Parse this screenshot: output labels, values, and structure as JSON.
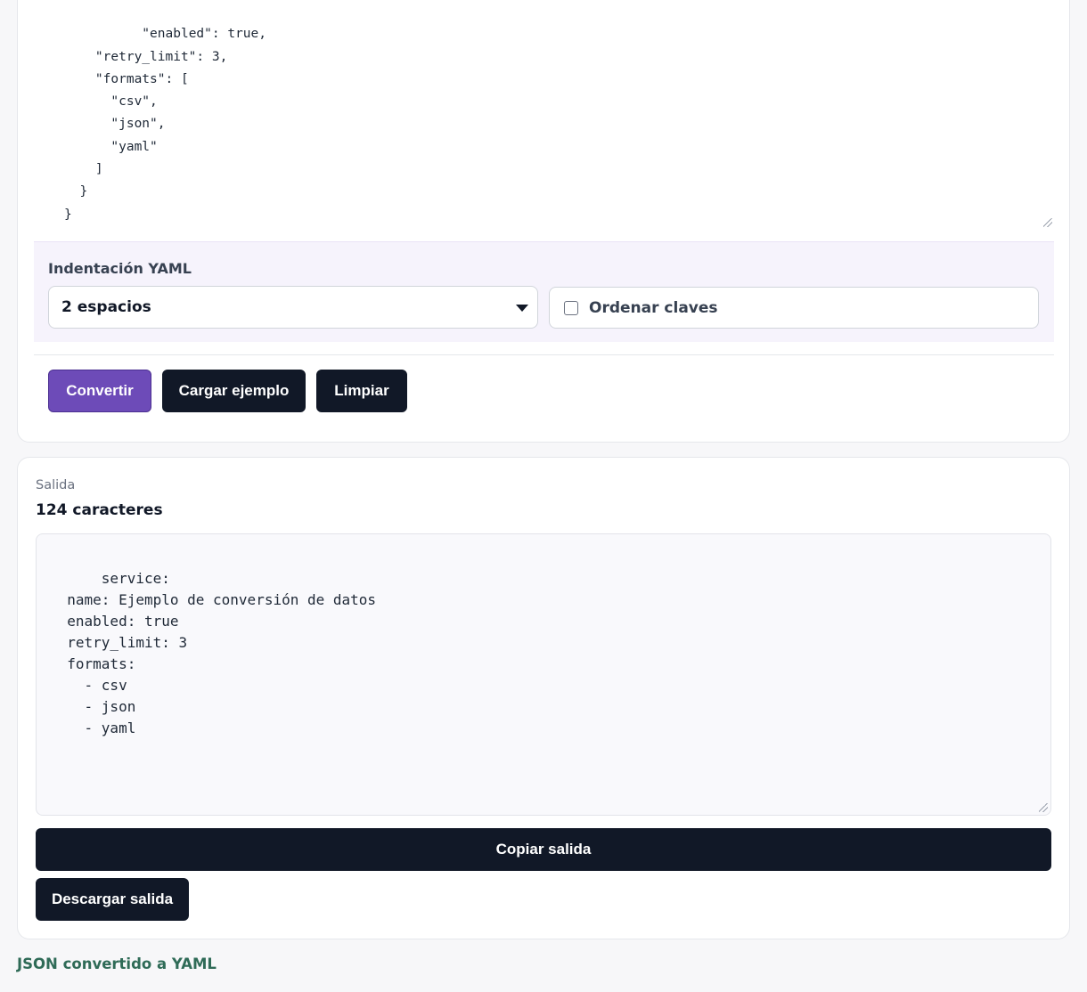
{
  "input": {
    "json_text": "    \"enabled\": true,\n    \"retry_limit\": 3,\n    \"formats\": [\n      \"csv\",\n      \"json\",\n      \"yaml\"\n    ]\n  }\n}"
  },
  "options": {
    "indent_label": "Indentación YAML",
    "indent_selected": "2 espacios",
    "sort_keys_label": "Ordenar claves",
    "sort_keys_checked": false
  },
  "actions": {
    "convert_label": "Convertir",
    "load_sample_label": "Cargar ejemplo",
    "clear_label": "Limpiar"
  },
  "output": {
    "kicker": "Salida",
    "char_count": "124 caracteres",
    "yaml_text": "service:\n  name: Ejemplo de conversión de datos\n  enabled: true\n  retry_limit: 3\n  formats:\n    - csv\n    - json\n    - yaml",
    "copy_label": "Copiar salida",
    "download_label": "Descargar salida"
  },
  "footer": {
    "status": "JSON convertido a YAML"
  },
  "colors": {
    "primary": "#6d4bb8",
    "dark_button": "#111827",
    "options_bg": "#f6f3fc",
    "status_text": "#2f6b57"
  }
}
